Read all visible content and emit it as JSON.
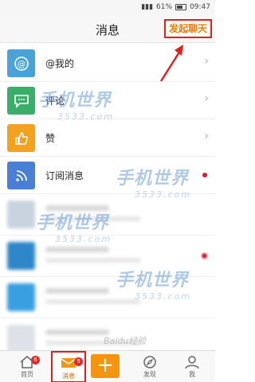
{
  "status_bar": {
    "battery": "61%",
    "time": "09:47"
  },
  "header": {
    "title": "消息",
    "action_label": "发起聊天"
  },
  "colors": {
    "accent_orange": "#f39412",
    "badge_red": "#e02a2a",
    "at_icon": "#4aa3d8",
    "comment_icon": "#3cae6b",
    "like_icon": "#f3a220",
    "subscribe_icon": "#4a7fd6"
  },
  "list": {
    "items": [
      {
        "label": "@我的",
        "icon": "at-icon"
      },
      {
        "label": "评论",
        "icon": "comment-icon"
      },
      {
        "label": "赞",
        "icon": "thumbs-up-icon"
      },
      {
        "label": "订阅消息",
        "icon": "rss-icon"
      }
    ]
  },
  "watermark": {
    "brand": "手机世界",
    "domain": "3533.com",
    "baidu": "Baidu经验"
  },
  "tabbar": {
    "home": {
      "label": "首页",
      "badge": "6",
      "icon": "home-icon"
    },
    "messages": {
      "label": "消息",
      "badge": "9",
      "icon": "envelope-icon"
    },
    "post": {
      "label": "+",
      "icon": "plus-icon"
    },
    "discover": {
      "label": "发现",
      "icon": "compass-icon"
    },
    "me": {
      "label": "我",
      "icon": "person-icon"
    }
  }
}
